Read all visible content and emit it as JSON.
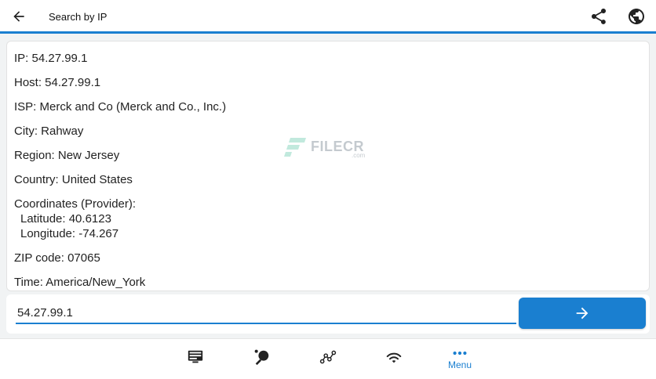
{
  "header": {
    "title": "Search by IP",
    "back_icon": "arrow-left-icon",
    "share_icon": "share-icon",
    "globe_icon": "globe-icon"
  },
  "result": {
    "ip": "IP: 54.27.99.1",
    "host": "Host: 54.27.99.1",
    "isp": "ISP: Merck and Co (Merck and Co., Inc.)",
    "city": "City: Rahway",
    "region": "Region: New Jersey",
    "country": "Country: United States",
    "coordinates_label": "Coordinates (Provider):",
    "latitude": "Latitude: 40.6123",
    "longitude": "Longitude: -74.267",
    "zip": "ZIP code: 07065",
    "time": "Time: America/New_York"
  },
  "watermark": {
    "text": "FILECR",
    "sub": ".com"
  },
  "search": {
    "value": "54.27.99.1"
  },
  "bottom_nav": {
    "items": [
      {
        "icon": "monitor-icon"
      },
      {
        "icon": "ping-pong-icon"
      },
      {
        "icon": "network-graph-icon"
      },
      {
        "icon": "wifi-icon"
      },
      {
        "icon": "more-dots-icon",
        "label": "Menu"
      }
    ]
  },
  "colors": {
    "accent": "#1a7fd0",
    "background": "#f1f3f4"
  }
}
